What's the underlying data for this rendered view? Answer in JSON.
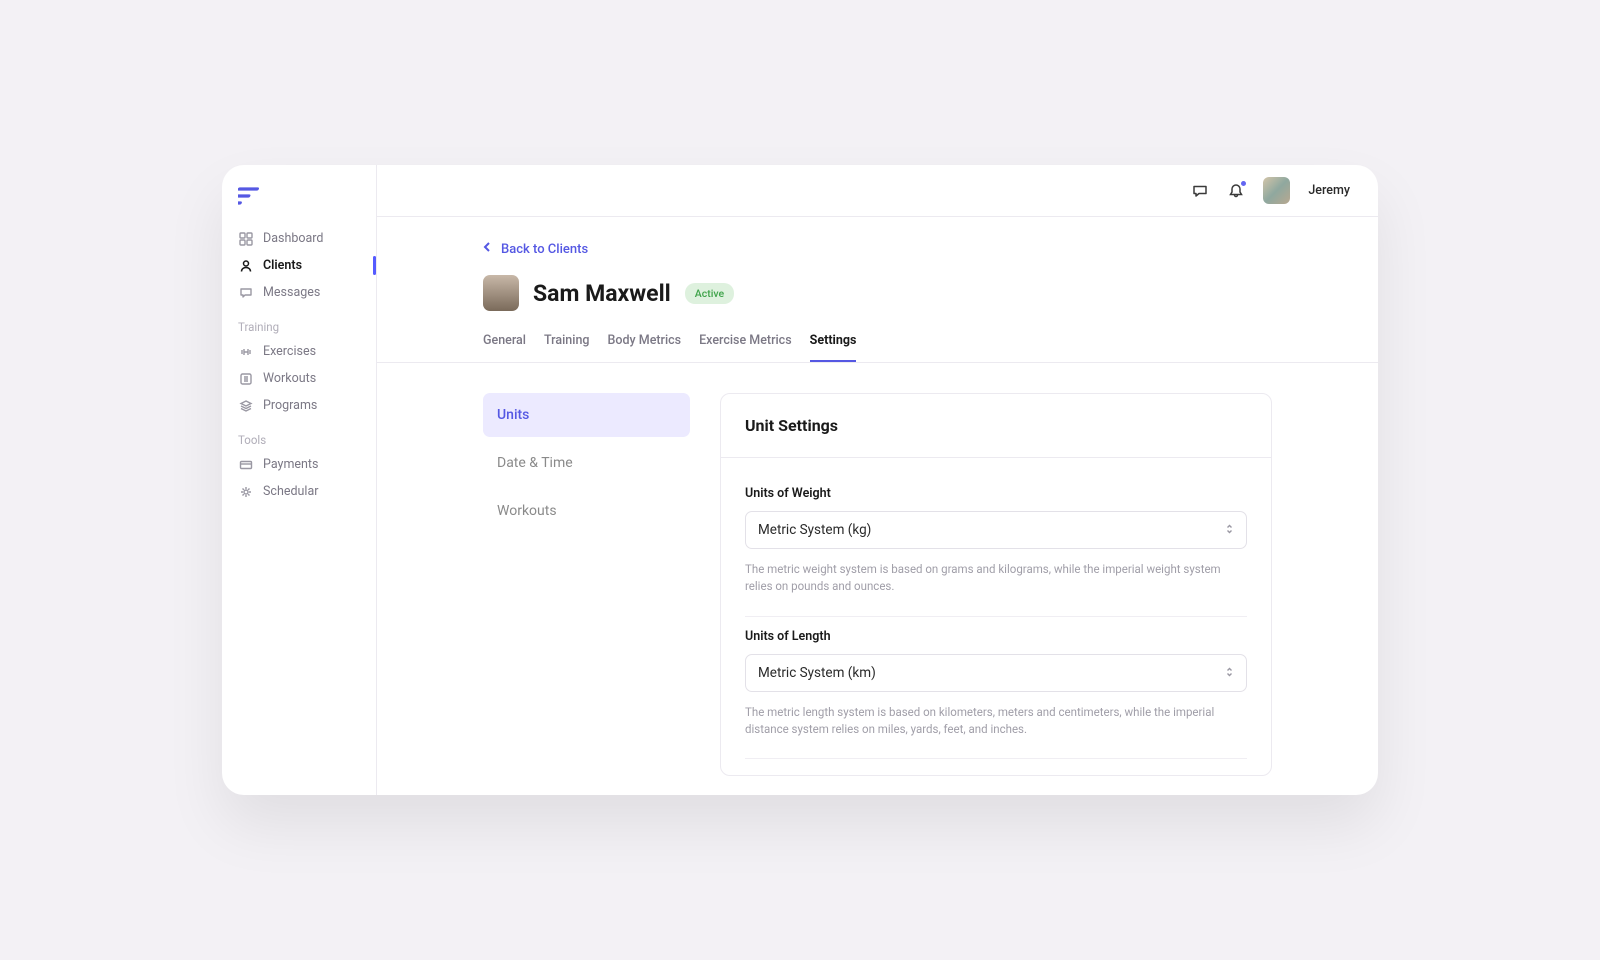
{
  "topbar": {
    "username": "Jeremy"
  },
  "sidebar": {
    "items": [
      {
        "label": "Dashboard"
      },
      {
        "label": "Clients"
      },
      {
        "label": "Messages"
      }
    ],
    "training_label": "Training",
    "training": [
      {
        "label": "Exercises"
      },
      {
        "label": "Workouts"
      },
      {
        "label": "Programs"
      }
    ],
    "tools_label": "Tools",
    "tools": [
      {
        "label": "Payments"
      },
      {
        "label": "Schedular"
      }
    ]
  },
  "back": {
    "label": "Back to Clients"
  },
  "client": {
    "name": "Sam Maxwell",
    "status": "Active"
  },
  "tabs": [
    {
      "label": "General"
    },
    {
      "label": "Training"
    },
    {
      "label": "Body Metrics"
    },
    {
      "label": "Exercise Metrics"
    },
    {
      "label": "Settings"
    }
  ],
  "settingsNav": [
    {
      "label": "Units"
    },
    {
      "label": "Date & Time"
    },
    {
      "label": "Workouts"
    }
  ],
  "panel": {
    "title": "Unit Settings",
    "weight": {
      "label": "Units of Weight",
      "value": "Metric System (kg)",
      "help": "The metric weight system is based on grams and kilograms, while the imperial weight system relies on pounds and ounces."
    },
    "length": {
      "label": "Units of Length",
      "value": "Metric System (km)",
      "help": "The metric length system is based on kilometers, meters and centimeters, while the imperial distance system relies on miles, yards, feet, and inches."
    }
  }
}
